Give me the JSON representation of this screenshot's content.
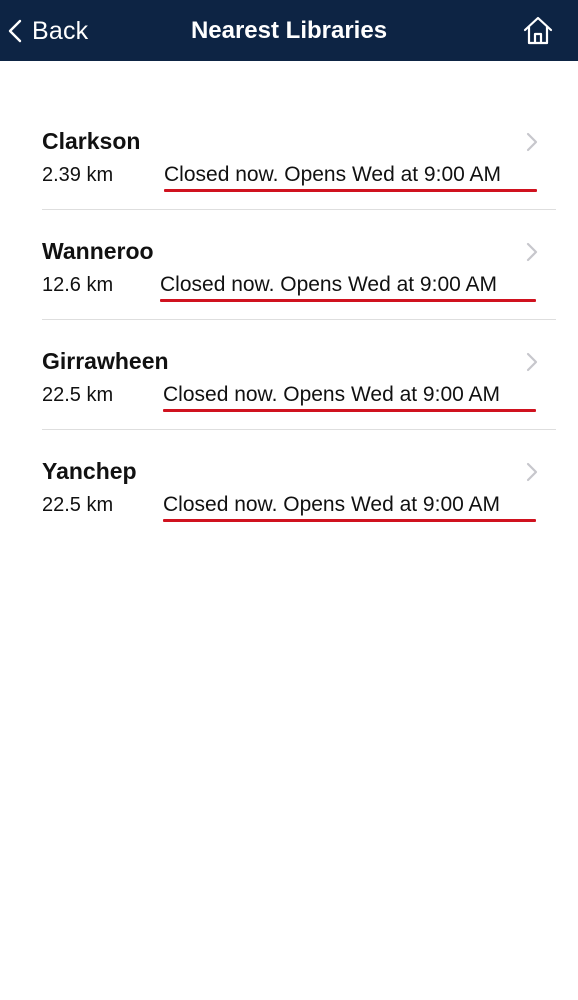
{
  "nav": {
    "back_label": "Back",
    "title": "Nearest Libraries",
    "back_icon": "chevron-left-icon",
    "home_icon": "home-icon",
    "background_color": "#0d2444"
  },
  "libraries": [
    {
      "name": "Clarkson",
      "distance": "2.39 km",
      "status": "Closed now. Opens Wed at 9:00 AM"
    },
    {
      "name": "Wanneroo",
      "distance": "12.6 km",
      "status": "Closed now. Opens Wed at 9:00 AM"
    },
    {
      "name": "Girrawheen",
      "distance": "22.5 km",
      "status": "Closed now. Opens Wed at 9:00 AM"
    },
    {
      "name": "Yanchep",
      "distance": "22.5 km",
      "status": "Closed now. Opens Wed at 9:00 AM"
    }
  ],
  "colors": {
    "accent_underline": "#d0121f",
    "chevron": "#c7c7cc"
  }
}
